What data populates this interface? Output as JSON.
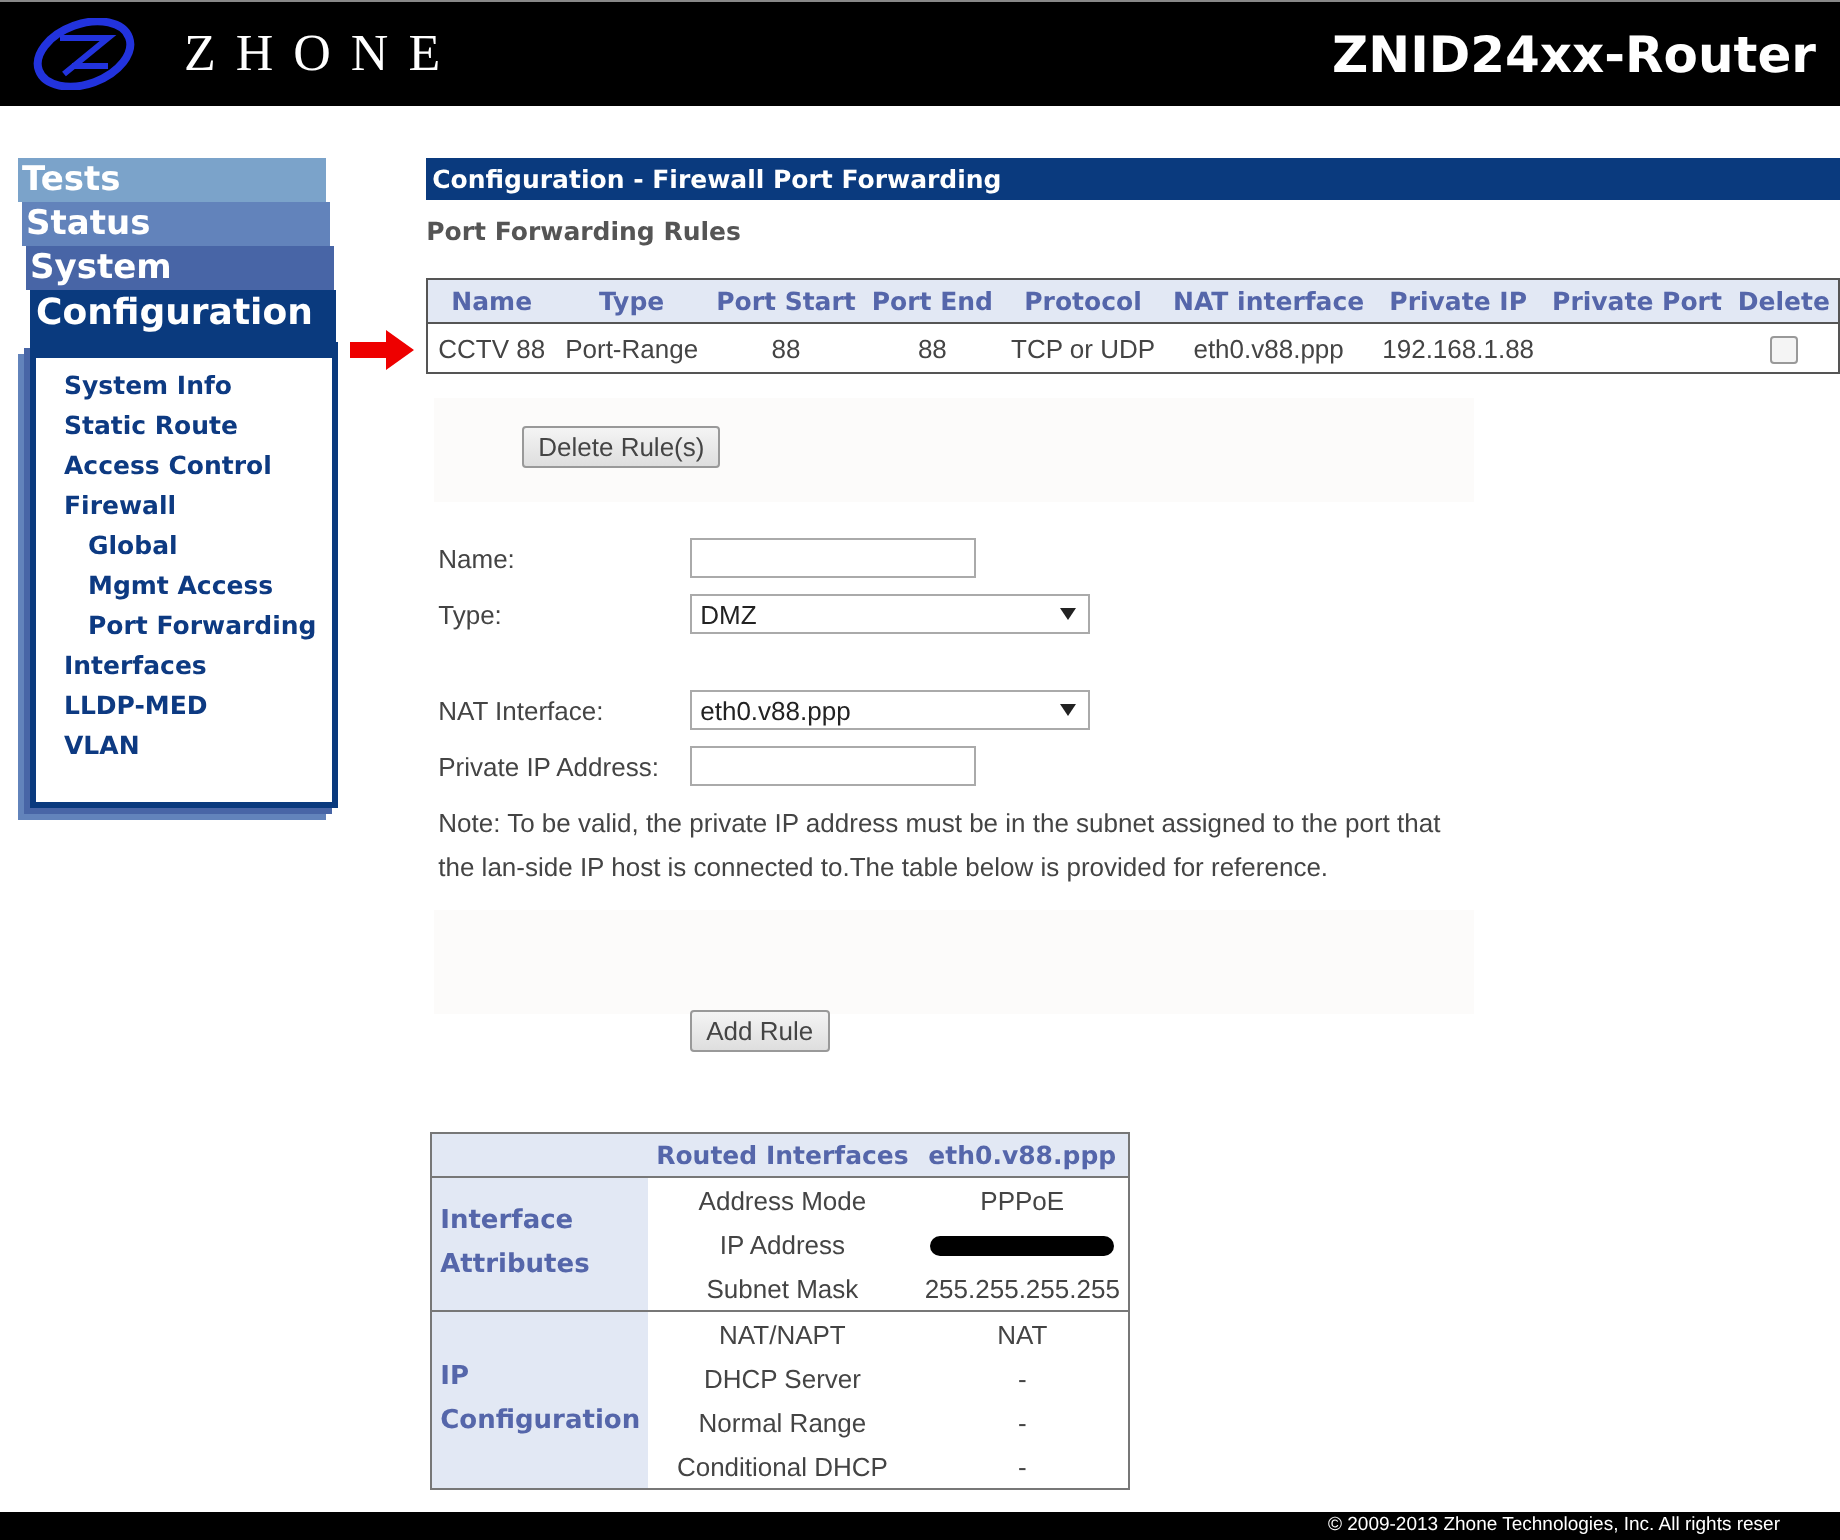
{
  "header": {
    "brand": "ZHONE",
    "title": "ZNID24xx-Router"
  },
  "sidebar": {
    "tabs": [
      {
        "label": "Tests",
        "selected": false
      },
      {
        "label": "Status",
        "selected": false
      },
      {
        "label": "System",
        "selected": false
      },
      {
        "label": "Configuration",
        "selected": true
      }
    ],
    "items": [
      {
        "label": "System Info"
      },
      {
        "label": "Static Route"
      },
      {
        "label": "Access Control"
      },
      {
        "label": "Firewall",
        "children": [
          {
            "label": "Global"
          },
          {
            "label": "Mgmt Access"
          },
          {
            "label": "Port Forwarding"
          }
        ]
      },
      {
        "label": "Interfaces"
      },
      {
        "label": "LLDP-MED"
      },
      {
        "label": "VLAN"
      }
    ]
  },
  "page_title": "Configuration - Firewall Port Forwarding",
  "section_title": "Port Forwarding Rules",
  "rules_table": {
    "columns": [
      "Name",
      "Type",
      "Port Start",
      "Port End",
      "Protocol",
      "NAT interface",
      "Private IP",
      "Private Port",
      "Delete"
    ],
    "rows": [
      {
        "cells": [
          "CCTV 88",
          "Port-Range",
          "88",
          "88",
          "TCP or UDP",
          "eth0.v88.ppp",
          "192.168.1.88",
          ""
        ],
        "checked": false
      }
    ]
  },
  "delete_button": "Delete Rule(s)",
  "form": [
    {
      "kind": "input",
      "label": "Name:"
    },
    {
      "kind": "select",
      "label": "Type:",
      "value": "DMZ"
    },
    {
      "kind": "select",
      "label": "NAT Interface:",
      "value": "eth0.v88.ppp"
    },
    {
      "kind": "input",
      "label": "Private IP Address:"
    }
  ],
  "note": [
    "Note: To be valid, the private IP address must be in the subnet assigned to the port that",
    "the lan-side IP host is connected to.The table below is provided for reference."
  ],
  "add_button": "Add Rule",
  "interfaces_table": {
    "heading": "Routed Interfaces",
    "interface": "eth0.v88.ppp",
    "groups": [
      {
        "label": [
          "Interface",
          "Attributes"
        ],
        "rows": [
          {
            "name": "Address Mode",
            "value": "PPPoE"
          },
          {
            "name": "IP Address",
            "redacted": true
          },
          {
            "name": "Subnet Mask",
            "value": "255.255.255.255"
          }
        ]
      },
      {
        "label": [
          "IP",
          "Configuration"
        ],
        "rows": [
          {
            "name": "NAT/NAPT",
            "value": "NAT"
          },
          {
            "name": "DHCP Server",
            "value": "-"
          },
          {
            "name": "Normal Range",
            "value": "-"
          },
          {
            "name": "Conditional DHCP",
            "value": "-"
          }
        ]
      }
    ]
  },
  "footer": "© 2009-2013 Zhone Technologies, Inc. All rights reser"
}
